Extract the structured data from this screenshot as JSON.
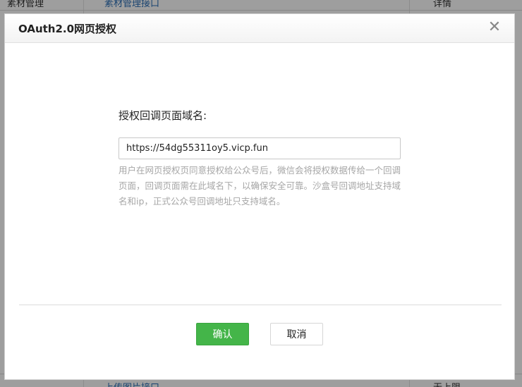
{
  "background": {
    "top_row": {
      "col1": "素材管理",
      "col2": "素材管理接口",
      "col3": "详情"
    },
    "bottom_row": {
      "col2": "上传图片接口",
      "col3": "无上限"
    }
  },
  "dialog": {
    "title": "OAuth2.0网页授权",
    "close_symbol": "✕",
    "field_label": "授权回调页面域名:",
    "input_value": "https://54dg55311oy5.vicp.fun",
    "hint": "用户在网页授权页同意授权给公众号后，微信会将授权数据传给一个回调页面，回调页面需在此域名下，以确保安全可靠。沙盒号回调地址支持域名和ip，正式公众号回调地址只支持域名。",
    "confirm_label": "确认",
    "cancel_label": "取消"
  },
  "colors": {
    "confirm_green": "#44b549",
    "hint_gray": "#a6a6a6"
  }
}
